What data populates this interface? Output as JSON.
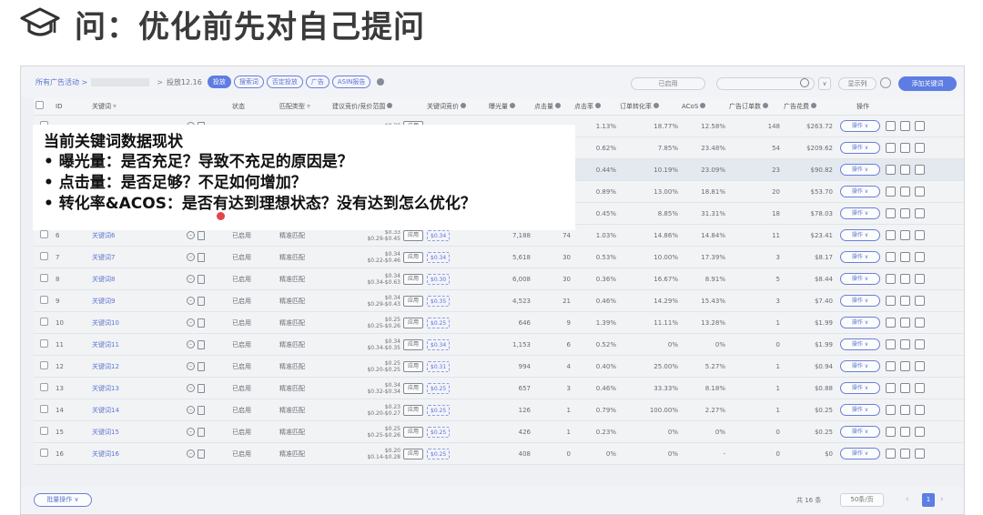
{
  "slide": {
    "title": "问：优化前先对自己提问",
    "icon": "graduation-cap-icon"
  },
  "toolbar": {
    "breadcrumb_root": "所有广告活动 >",
    "breadcrumb_sep": ">",
    "breadcrumb_current": "投放12.16",
    "tabs": [
      {
        "label": "投放",
        "active": true
      },
      {
        "label": "搜索词",
        "active": false
      },
      {
        "label": "否定投放",
        "active": false
      },
      {
        "label": "广告",
        "active": false
      },
      {
        "label": "ASIN报告",
        "active": false
      }
    ],
    "status_select": "已启用",
    "show_columns": "显示列",
    "add_button": "添加关键词",
    "mode_glyph": "∨"
  },
  "table": {
    "headers": [
      "ID",
      "关键词",
      "状态",
      "匹配类型",
      "建议竞价/竞价范围",
      "关键词竞价",
      "曝光量",
      "点击量",
      "点击率",
      "订单转化率",
      "ACoS",
      "广告订单数",
      "广告花费",
      "操作"
    ],
    "rows": [
      {
        "id": "",
        "kw": "",
        "status": "",
        "match": "",
        "bid": "$0.33",
        "range": "",
        "kwbid": "",
        "imp": "",
        "clk": "",
        "ctr": "1.13%",
        "cvr": "18.77%",
        "acos": "12.58%",
        "orders": "148",
        "spend": "$263.72"
      },
      {
        "id": "",
        "kw": "",
        "status": "",
        "match": "",
        "bid": "",
        "range": "",
        "kwbid": "",
        "imp": "",
        "clk": "",
        "ctr": "0.62%",
        "cvr": "7.85%",
        "acos": "23.48%",
        "orders": "54",
        "spend": "$209.62"
      },
      {
        "id": "",
        "kw": "",
        "status": "",
        "match": "",
        "bid": "",
        "range": "",
        "kwbid": "",
        "imp": "",
        "clk": "",
        "ctr": "0.44%",
        "cvr": "10.19%",
        "acos": "23.09%",
        "orders": "23",
        "spend": "$90.82"
      },
      {
        "id": "",
        "kw": "",
        "status": "",
        "match": "",
        "bid": "",
        "range": "",
        "kwbid": "",
        "imp": "",
        "clk": "",
        "ctr": "0.89%",
        "cvr": "13.00%",
        "acos": "18.81%",
        "orders": "20",
        "spend": "$53.70"
      },
      {
        "id": "",
        "kw": "",
        "status": "",
        "match": "",
        "bid": "",
        "range": "",
        "kwbid": "",
        "imp": "",
        "clk": "",
        "ctr": "0.45%",
        "cvr": "8.85%",
        "acos": "31.31%",
        "orders": "18",
        "spend": "$78.03"
      },
      {
        "id": "6",
        "kw": "关键词6",
        "status": "已启用",
        "match": "精准匹配",
        "bid": "$0.33",
        "range": "$0.29-$0.45",
        "kwbid": "$0.34",
        "imp": "7,188",
        "clk": "74",
        "ctr": "1.03%",
        "cvr": "14.86%",
        "acos": "14.84%",
        "orders": "11",
        "spend": "$23.41"
      },
      {
        "id": "7",
        "kw": "关键词7",
        "status": "已启用",
        "match": "精准匹配",
        "bid": "$0.34",
        "range": "$0.22-$0.46",
        "kwbid": "$0.34",
        "imp": "5,618",
        "clk": "30",
        "ctr": "0.53%",
        "cvr": "10.00%",
        "acos": "17.39%",
        "orders": "3",
        "spend": "$8.17"
      },
      {
        "id": "8",
        "kw": "关键词8",
        "status": "已启用",
        "match": "精准匹配",
        "bid": "$0.34",
        "range": "$0.34-$0.63",
        "kwbid": "$0.30",
        "imp": "6,008",
        "clk": "30",
        "ctr": "0.36%",
        "cvr": "16.67%",
        "acos": "8.91%",
        "orders": "5",
        "spend": "$8.44"
      },
      {
        "id": "9",
        "kw": "关键词9",
        "status": "已启用",
        "match": "精准匹配",
        "bid": "$0.34",
        "range": "$0.29-$0.43",
        "kwbid": "$0.35",
        "imp": "4,523",
        "clk": "21",
        "ctr": "0.46%",
        "cvr": "14.29%",
        "acos": "15.43%",
        "orders": "3",
        "spend": "$7.40"
      },
      {
        "id": "10",
        "kw": "关键词10",
        "status": "已启用",
        "match": "精准匹配",
        "bid": "$0.25",
        "range": "$0.25-$0.26",
        "kwbid": "$0.25",
        "imp": "646",
        "clk": "9",
        "ctr": "1.39%",
        "cvr": "11.11%",
        "acos": "13.28%",
        "orders": "1",
        "spend": "$1.99"
      },
      {
        "id": "11",
        "kw": "关键词11",
        "status": "已启用",
        "match": "精准匹配",
        "bid": "$0.34",
        "range": "$0.34-$0.35",
        "kwbid": "$0.34",
        "imp": "1,153",
        "clk": "6",
        "ctr": "0.52%",
        "cvr": "0%",
        "acos": "0%",
        "orders": "0",
        "spend": "$1.99"
      },
      {
        "id": "12",
        "kw": "关键词12",
        "status": "已启用",
        "match": "精准匹配",
        "bid": "$0.25",
        "range": "$0.20-$0.25",
        "kwbid": "$0.31",
        "imp": "994",
        "clk": "4",
        "ctr": "0.40%",
        "cvr": "25.00%",
        "acos": "5.27%",
        "orders": "1",
        "spend": "$0.94"
      },
      {
        "id": "13",
        "kw": "关键词13",
        "status": "已启用",
        "match": "精准匹配",
        "bid": "$0.34",
        "range": "$0.32-$0.34",
        "kwbid": "$0.25",
        "imp": "657",
        "clk": "3",
        "ctr": "0.46%",
        "cvr": "33.33%",
        "acos": "8.18%",
        "orders": "1",
        "spend": "$0.88"
      },
      {
        "id": "14",
        "kw": "关键词14",
        "status": "已启用",
        "match": "精准匹配",
        "bid": "$0.23",
        "range": "$0.20-$0.27",
        "kwbid": "$0.25",
        "imp": "126",
        "clk": "1",
        "ctr": "0.79%",
        "cvr": "100.00%",
        "acos": "2.27%",
        "orders": "1",
        "spend": "$0.25"
      },
      {
        "id": "15",
        "kw": "关键词15",
        "status": "已启用",
        "match": "精准匹配",
        "bid": "$0.25",
        "range": "$0.25-$0.26",
        "kwbid": "$0.25",
        "imp": "426",
        "clk": "1",
        "ctr": "0.23%",
        "cvr": "0%",
        "acos": "0%",
        "orders": "0",
        "spend": "$0.25"
      },
      {
        "id": "16",
        "kw": "关键词16",
        "status": "已启用",
        "match": "精准匹配",
        "bid": "$0.20",
        "range": "$0.14-$0.28",
        "kwbid": "$0.25",
        "imp": "408",
        "clk": "0",
        "ctr": "0%",
        "cvr": "0%",
        "acos": "-",
        "orders": "0",
        "spend": "$0"
      }
    ],
    "apply_label": "应用",
    "op_label": "操作 ∨"
  },
  "footer": {
    "bulk_label": "批量操作 ∨",
    "total": "共 16 条",
    "page_size": "50条/页",
    "prev": "‹",
    "current_page": "1",
    "next": "›"
  },
  "note": {
    "title": "当前关键词数据现状",
    "items": [
      "• 曝光量：是否充足？导致不充足的原因是？",
      "• 点击量：是否足够？不足如何增加？",
      "• 转化率&ACOS：是否有达到理想状态？没有达到怎么优化？"
    ]
  }
}
